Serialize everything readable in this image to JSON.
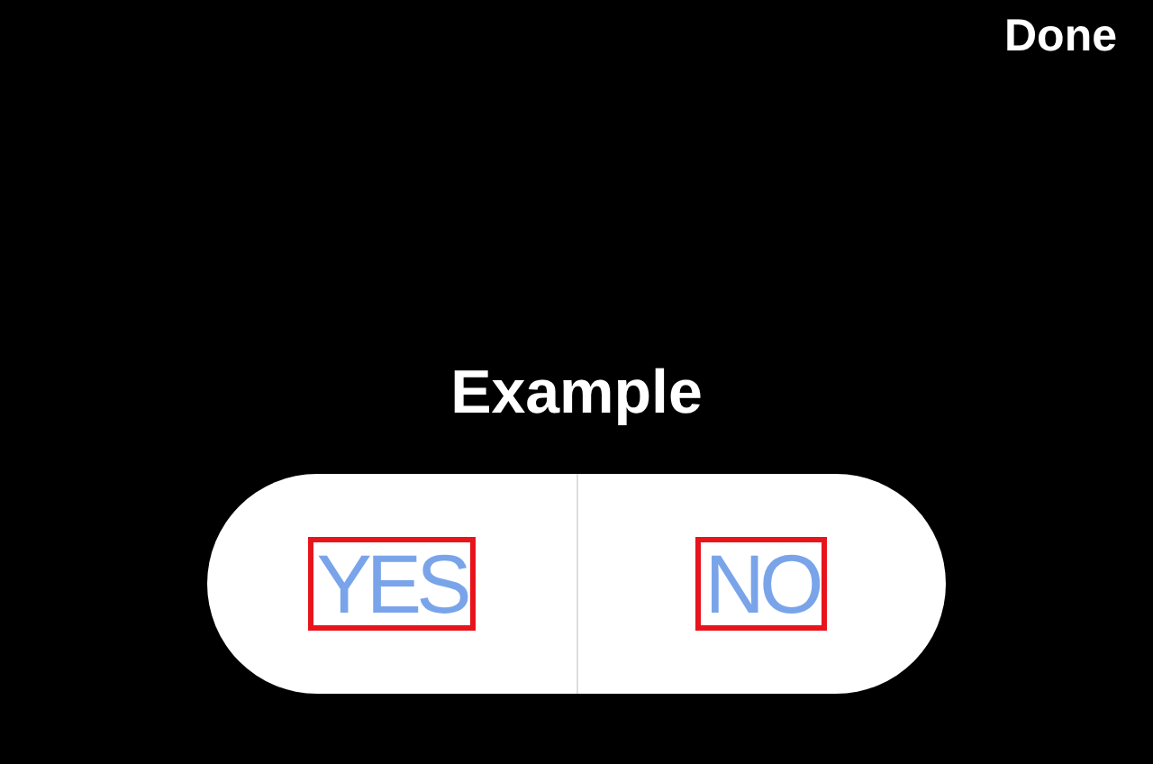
{
  "done_button": "Done",
  "poll": {
    "question": "Example",
    "options": [
      {
        "label": "YES",
        "outlined": true
      },
      {
        "label": "NO",
        "outlined": true
      }
    ]
  }
}
